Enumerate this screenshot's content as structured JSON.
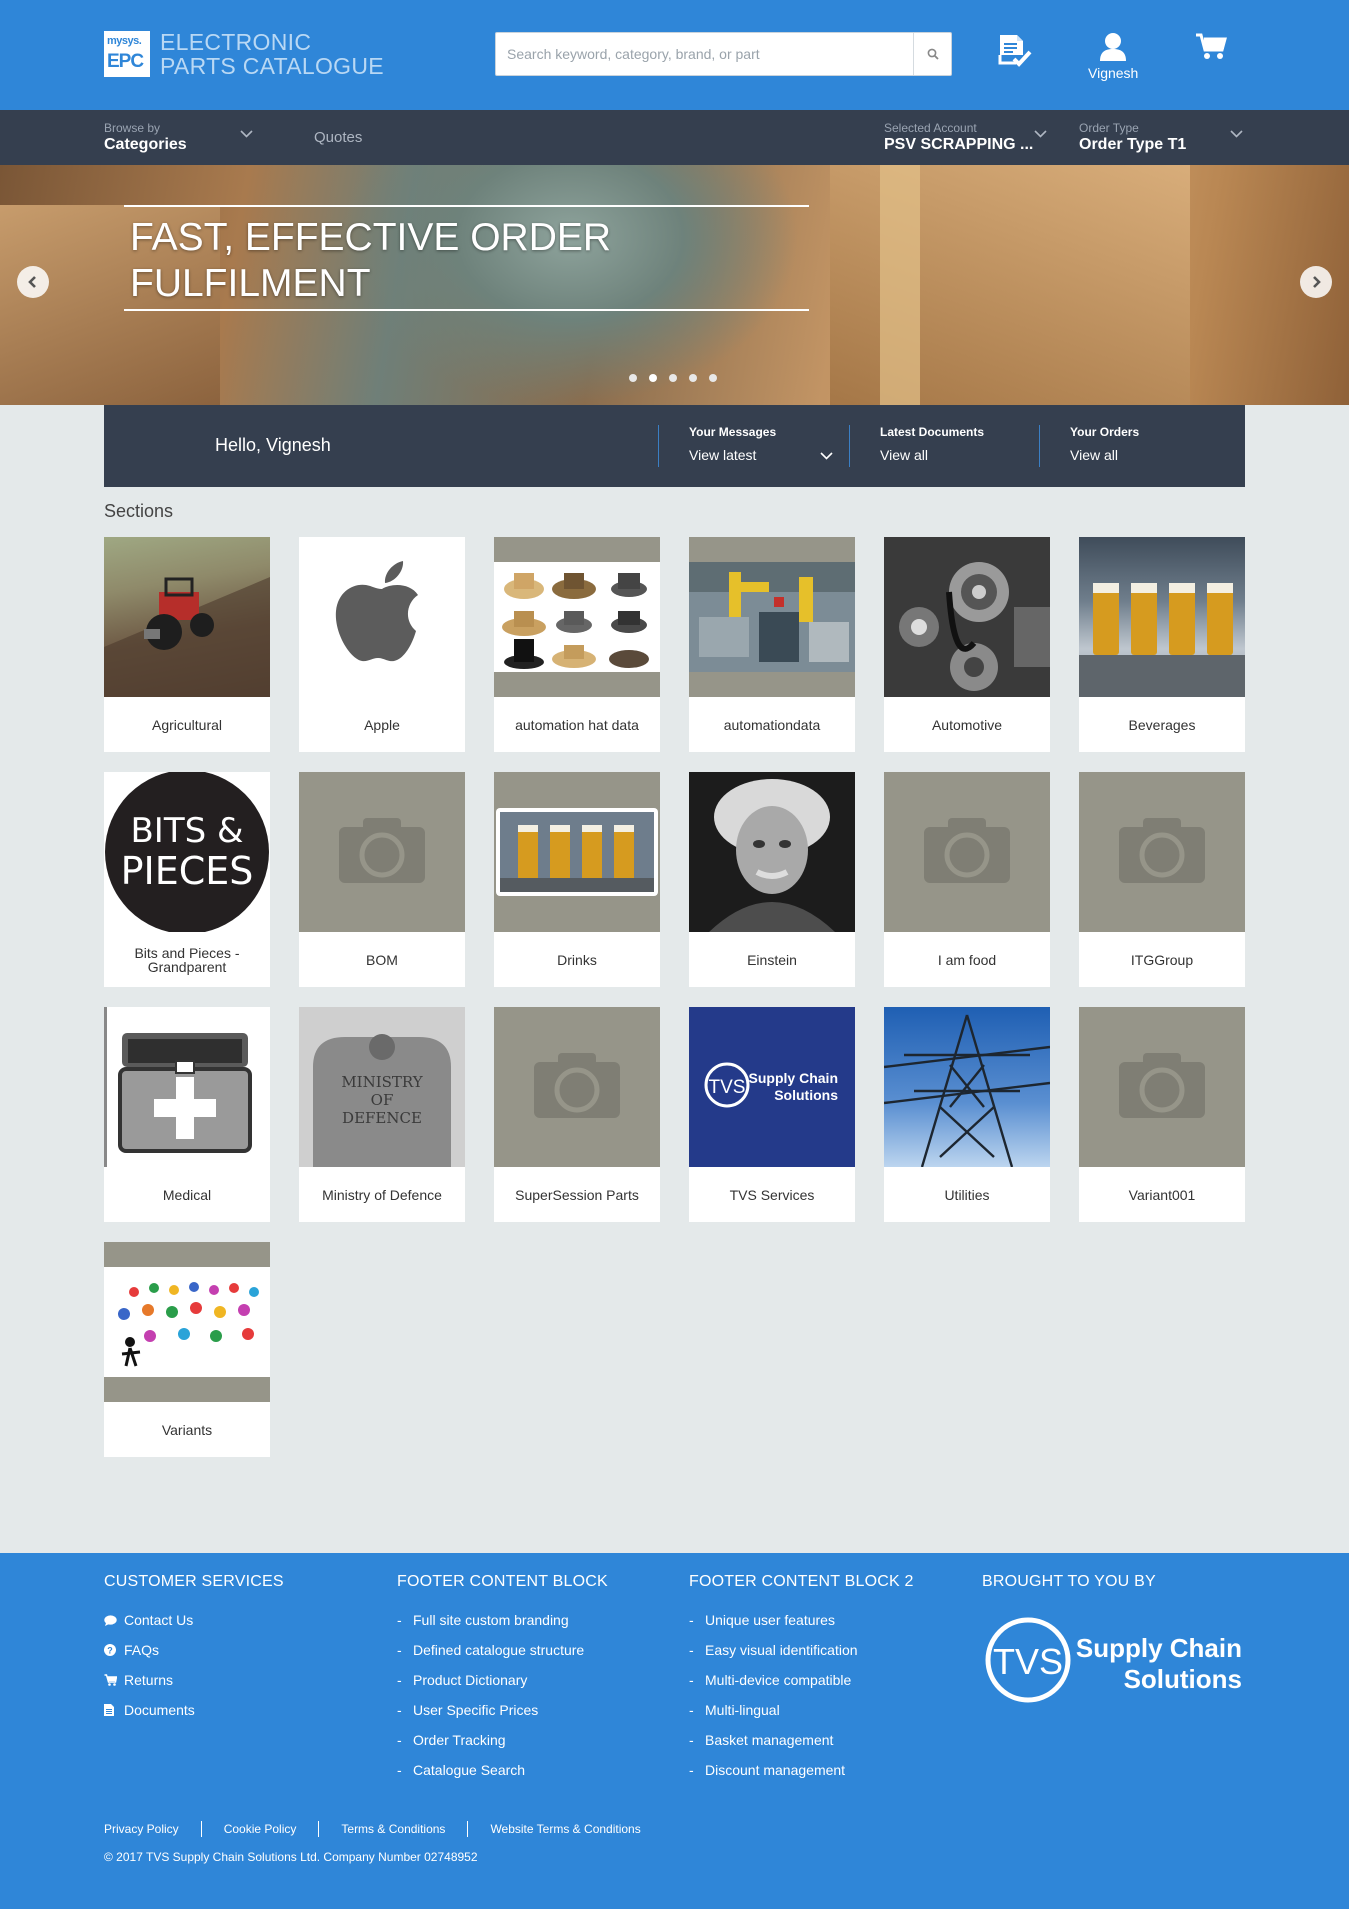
{
  "header": {
    "logo_top": "mysys.",
    "logo_mark": "EPC",
    "logo_line1": "ELECTRONIC",
    "logo_line2": "PARTS CATALOGUE",
    "search_placeholder": "Search keyword, category, brand, or part",
    "user_label": "Vignesh"
  },
  "nav": {
    "browse_small": "Browse by",
    "browse_big": "Categories",
    "quotes": "Quotes",
    "account_small": "Selected Account",
    "account_big": "PSV SCRAPPING ...",
    "order_small": "Order Type",
    "order_big": "Order Type T1"
  },
  "banner": {
    "title_line1": "FAST, EFFECTIVE ORDER",
    "title_line2": "FULFILMENT",
    "slide_count": 5
  },
  "welcome": {
    "hello": "Hello, Vignesh",
    "messages_title": "Your Messages",
    "messages_value": "View latest",
    "documents_title": "Latest Documents",
    "documents_value": "View all",
    "orders_title": "Your Orders",
    "orders_value": "View all"
  },
  "sections": {
    "title": "Sections",
    "tiles": [
      {
        "label": "Agricultural",
        "image": "tractor"
      },
      {
        "label": "Apple",
        "image": "apple-logo"
      },
      {
        "label": "automation hat data",
        "image": "hats"
      },
      {
        "label": "automationdata",
        "image": "factory"
      },
      {
        "label": "Automotive",
        "image": "engine"
      },
      {
        "label": "Beverages",
        "image": "beer-glasses"
      },
      {
        "label": "Bits and Pieces - Grandparent",
        "image": "bits-and-pieces"
      },
      {
        "label": "BOM",
        "image": "placeholder-camera"
      },
      {
        "label": "Drinks",
        "image": "beer-glasses-small"
      },
      {
        "label": "Einstein",
        "image": "portrait"
      },
      {
        "label": "I am food",
        "image": "placeholder-camera"
      },
      {
        "label": "ITGGroup",
        "image": "placeholder-camera"
      },
      {
        "label": "Medical",
        "image": "first-aid-box"
      },
      {
        "label": "Ministry of Defence",
        "image": "mod-plaque"
      },
      {
        "label": "SuperSession Parts",
        "image": "placeholder-camera"
      },
      {
        "label": "TVS Services",
        "image": "tvs-logo"
      },
      {
        "label": "Utilities",
        "image": "pylon"
      },
      {
        "label": "Variant001",
        "image": "placeholder-camera"
      },
      {
        "label": "Variants",
        "image": "figures"
      }
    ],
    "bits_text_1": "BITS &",
    "bits_text_2": "PIECES",
    "mod_text": [
      "MINISTRY",
      "OF",
      "DEFENCE"
    ],
    "tvs_text_1": "Supply Chain",
    "tvs_text_2": "Solutions"
  },
  "footer": {
    "col1_title": "CUSTOMER SERVICES",
    "col1_items": [
      "Contact Us",
      "FAQs",
      "Returns",
      "Documents"
    ],
    "col1_icons": [
      "comment-icon",
      "question-icon",
      "cart-icon",
      "document-icon"
    ],
    "col2_title": "FOOTER CONTENT BLOCK",
    "col2_items": [
      "Full site custom branding",
      "Defined catalogue structure",
      "Product Dictionary",
      "User Specific Prices",
      "Order Tracking",
      "Catalogue Search"
    ],
    "col3_title": "FOOTER CONTENT BLOCK 2",
    "col3_items": [
      "Unique user features",
      "Easy visual identification",
      "Multi-device compatible",
      "Multi-lingual",
      "Basket management",
      "Discount management"
    ],
    "col4_title": "BROUGHT TO YOU BY",
    "brand_mark": "TVS",
    "brand_line1": "Supply Chain",
    "brand_line2": "Solutions",
    "legal_links": [
      "Privacy Policy",
      "Cookie Policy",
      "Terms & Conditions",
      "Website Terms & Conditions"
    ],
    "copyright": "© 2017 TVS Supply Chain Solutions Ltd. Company Number 02748952"
  },
  "colors": {
    "primary": "#2f86d8",
    "nav_dark": "#353f4f",
    "page_bg": "#e4e9ea",
    "placeholder": "#969589"
  }
}
